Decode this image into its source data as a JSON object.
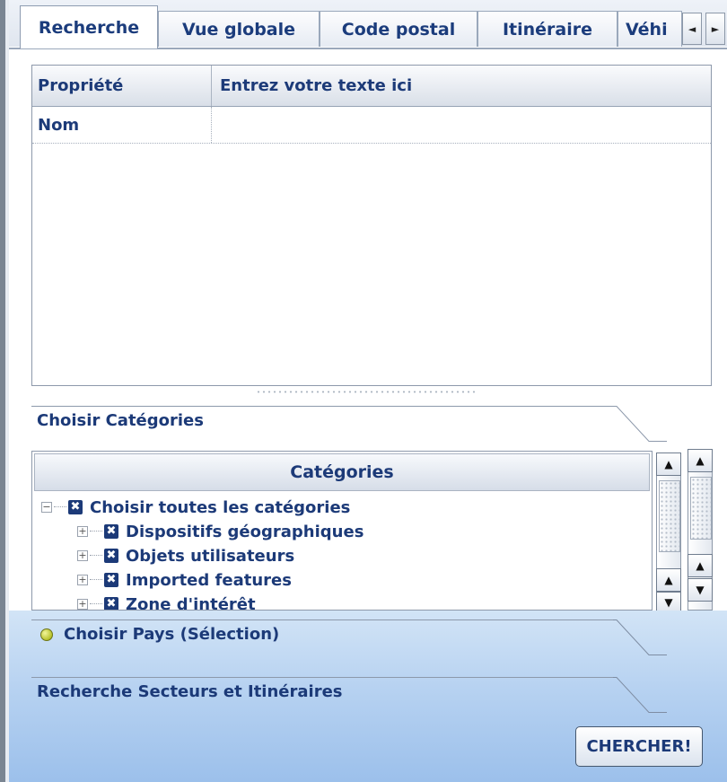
{
  "tabs": [
    {
      "label": "Recherche",
      "active": true
    },
    {
      "label": "Vue globale",
      "active": false
    },
    {
      "label": "Code postal",
      "active": false
    },
    {
      "label": "Itinéraire",
      "active": false
    },
    {
      "label": "Véhi",
      "active": false
    }
  ],
  "tab_scroll": {
    "left_icon": "◄",
    "right_icon": "►"
  },
  "property_grid": {
    "col_property": "Propriété",
    "col_value": "Entrez votre texte ici",
    "rows": [
      {
        "property": "Nom",
        "value": ""
      }
    ]
  },
  "sections": {
    "categories_title": "Choisir Catégories",
    "country_title": "Choisir Pays (Sélection)",
    "sectors_title": "Recherche Secteurs et Itinéraires"
  },
  "categories": {
    "header": "Catégories",
    "root": {
      "label": "Choisir toutes les catégories",
      "expander": "⊟",
      "checked_icon": "✖"
    },
    "items": [
      {
        "label": "Dispositifs géographiques",
        "expander": "⊞"
      },
      {
        "label": "Objets utilisateurs",
        "expander": "⊞"
      },
      {
        "label": "Imported features",
        "expander": "⊞"
      },
      {
        "label": "Zone d'intérêt",
        "expander": "⊞"
      }
    ]
  },
  "scroll_icons": {
    "up": "▲",
    "down": "▼"
  },
  "actions": {
    "search_label": "CHERCHER!"
  },
  "colors": {
    "text": "#1c3a78",
    "accent_bottom": "#9cc0eb",
    "status_dot": "#b7c22b"
  }
}
